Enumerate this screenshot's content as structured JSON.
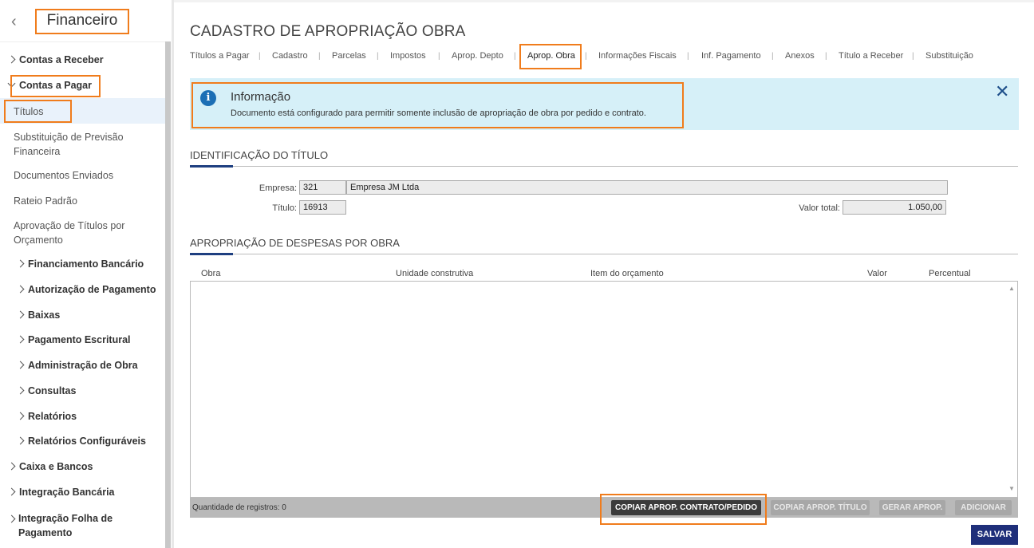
{
  "sidebar": {
    "title": "Financeiro",
    "back_icon": "chevron-left-icon",
    "items": [
      {
        "label": "Contas a Receber"
      },
      {
        "label": "Contas a Pagar"
      },
      {
        "label": "Títulos"
      },
      {
        "label": "Substituição de Previsão Financeira"
      },
      {
        "label": "Documentos Enviados"
      },
      {
        "label": "Rateio Padrão"
      },
      {
        "label": "Aprovação de Títulos por Orçamento"
      },
      {
        "label": "Financiamento Bancário"
      },
      {
        "label": "Autorização de Pagamento"
      },
      {
        "label": "Baixas"
      },
      {
        "label": "Pagamento Escritural"
      },
      {
        "label": "Administração de Obra"
      },
      {
        "label": "Consultas"
      },
      {
        "label": "Relatórios"
      },
      {
        "label": "Relatórios Configuráveis"
      },
      {
        "label": "Caixa e Bancos"
      },
      {
        "label": "Integração Bancária"
      },
      {
        "label": "Integração Folha de Pagamento"
      }
    ]
  },
  "page": {
    "title": "CADASTRO DE APROPRIAÇÃO OBRA",
    "tabs": [
      {
        "label": "Títulos a Pagar"
      },
      {
        "label": "Cadastro"
      },
      {
        "label": "Parcelas"
      },
      {
        "label": "Impostos"
      },
      {
        "label": "Aprop. Depto"
      },
      {
        "label": "Aprop. Obra"
      },
      {
        "label": "Informações Fiscais"
      },
      {
        "label": "Inf. Pagamento"
      },
      {
        "label": "Anexos"
      },
      {
        "label": "Título a Receber"
      },
      {
        "label": "Substituição"
      }
    ],
    "active_tab": "Aprop. Obra"
  },
  "info": {
    "title": "Informação",
    "text": "Documento está configurado para permitir somente inclusão de apropriação de obra por pedido e contrato.",
    "icon": "info-icon",
    "close_icon": "close-icon"
  },
  "identificacao": {
    "heading": "IDENTIFICAÇÃO DO TÍTULO",
    "empresa_label": "Empresa:",
    "empresa_code": "321",
    "empresa_name": "Empresa JM Ltda",
    "titulo_label": "Título:",
    "titulo_value": "16913",
    "valor_label": "Valor total:",
    "valor_value": "1.050,00"
  },
  "apropriacao": {
    "heading": "APROPRIAÇÃO DE DESPESAS POR OBRA",
    "columns": [
      "Obra",
      "Unidade construtiva",
      "Item do orçamento",
      "Valor",
      "Percentual"
    ],
    "rows": [],
    "count_label": "Quantidade de registros: 0",
    "buttons": {
      "copiar_contrato": "COPIAR APROP. CONTRATO/PEDIDO",
      "copiar_titulo": "COPIAR APROP. TÍTULO",
      "gerar": "GERAR APROP.",
      "adicionar": "ADICIONAR"
    }
  },
  "save_label": "SALVAR",
  "colors": {
    "highlight": "#f07c1c",
    "info_bg": "#d6f0f8",
    "accent": "#1e3f80",
    "save_bg": "#1f2f7a"
  }
}
